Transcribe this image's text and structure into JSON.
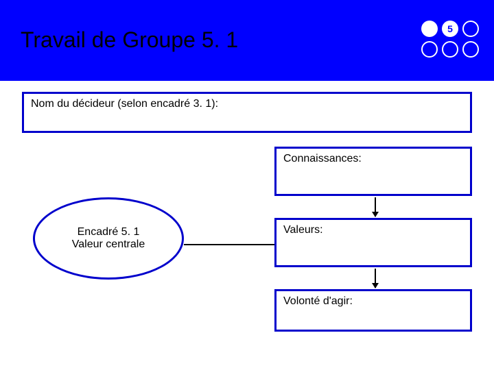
{
  "header": {
    "title": "Travail de Groupe 5. 1",
    "logo": {
      "number": "5"
    }
  },
  "boxes": {
    "decideur": "Nom du décideur (selon encadré 3. 1):",
    "connaissances": "Connaissances:",
    "valeurs": "Valeurs:",
    "volonte": "Volonté d'agir:"
  },
  "ellipse": {
    "line1": "Encadré 5. 1",
    "line2": "Valeur centrale"
  }
}
